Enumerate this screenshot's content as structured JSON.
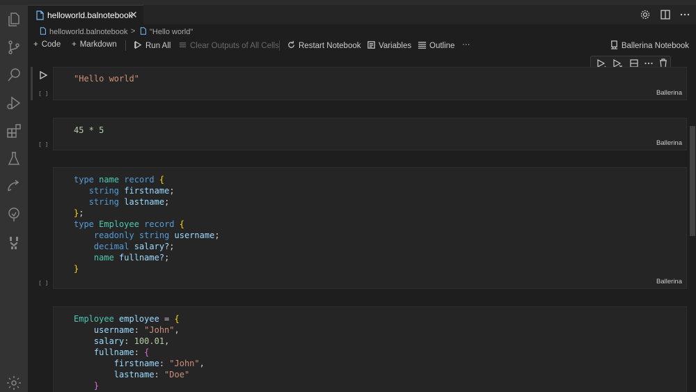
{
  "tab": {
    "label": "helloworld.balnotebook",
    "close": "✕"
  },
  "breadcrumb": {
    "file": "helloworld.balnotebook",
    "sep": ">",
    "cell": "\"Hello world\""
  },
  "toolbar": {
    "code": "Code",
    "markdown": "Markdown",
    "run_all": "Run All",
    "clear_outputs": "Clear Outputs of All Cells",
    "restart": "Restart Notebook",
    "variables": "Variables",
    "outline": "Outline",
    "more": "···",
    "kernel": "Ballerina Notebook"
  },
  "cells": [
    {
      "exec_count": "[ ]",
      "language": "Ballerina"
    },
    {
      "exec_count": "[ ]",
      "language": "Ballerina"
    },
    {
      "exec_count": "[ ]",
      "language": "Ballerina"
    }
  ],
  "code": {
    "c1_l1": "\"Hello world\"",
    "c2_l1": "45 * 5",
    "c3": {
      "type": "type",
      "name": "name",
      "record": "record",
      "string": "string",
      "firstname": "firstname",
      "lastname": "lastname",
      "Employee": "Employee",
      "readonly": "readonly",
      "username": "username",
      "decimal": "decimal",
      "salary": "salary?",
      "fullname": "fullname?"
    },
    "c4": {
      "Employee": "Employee",
      "employee": "employee",
      "username": "username",
      "john": "\"John\"",
      "salary": "salary",
      "salary_val": "100.01",
      "fullname": "fullname",
      "firstname": "firstname",
      "lastname": "lastname",
      "doe": "\"Doe\""
    }
  },
  "colors": {
    "keyword": "#569cd6",
    "type": "#4ec9b0",
    "variable": "#9cdcfe",
    "string": "#ce9178",
    "number": "#b5cea8",
    "bracket": "#ffd700"
  }
}
